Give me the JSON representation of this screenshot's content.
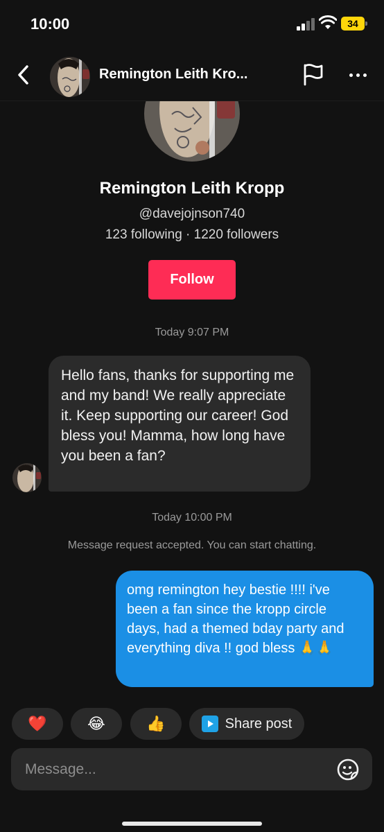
{
  "status_bar": {
    "time": "10:00",
    "battery": "34",
    "icons": [
      "signal-icon",
      "wifi-icon",
      "battery-icon"
    ]
  },
  "header": {
    "title": "Remington Leith Kro...",
    "icons": [
      "back-chevron-icon",
      "flag-icon",
      "more-icon"
    ]
  },
  "profile": {
    "name": "Remington Leith Kropp",
    "handle": "@davejojnson740",
    "stats": "123 following · 1220 followers",
    "follow_label": "Follow"
  },
  "messages": {
    "timestamp_1": "Today 9:07 PM",
    "incoming": "Hello fans, thanks for supporting me and my band! We really appreciate it. Keep supporting our career! God bless you! Mamma, how long have you been a fan?",
    "timestamp_2": "Today 10:00 PM",
    "system_note": "Message request accepted. You can start chatting.",
    "outgoing": "omg remington hey bestie !!!! i've been a fan since the kropp circle days, had a themed bday party and everything diva !! god bless 🙏🙏"
  },
  "quick_replies": {
    "heart": "❤️",
    "laugh": "😂",
    "thumbs_up": "👍",
    "share_label": "Share post"
  },
  "composer": {
    "placeholder": "Message...",
    "icons": [
      "emoji-sticker-icon"
    ]
  },
  "colors": {
    "background": "#121212",
    "follow": "#fe2c55",
    "outgoing_bubble": "#1b8fe5",
    "incoming_bubble": "#2b2b2b",
    "battery": "#ffd60a"
  }
}
